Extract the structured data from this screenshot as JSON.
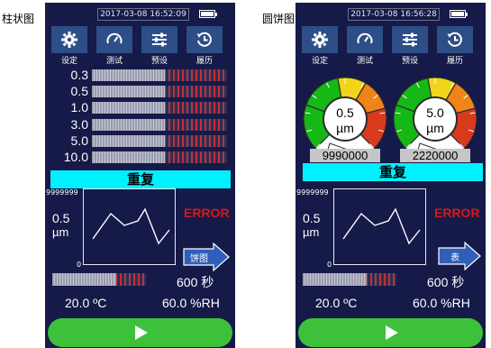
{
  "captions": {
    "left": "柱状图",
    "right": "圆饼图"
  },
  "nav": [
    {
      "icon": "gear-icon",
      "label": "设定"
    },
    {
      "icon": "gauge-icon",
      "label": "测试"
    },
    {
      "icon": "sliders-icon",
      "label": "预设"
    },
    {
      "icon": "history-icon",
      "label": "履历"
    }
  ],
  "bar_panel": {
    "datetime": "2017-03-08 16:52:09",
    "rows": [
      {
        "size": "0.3",
        "level": 0.54
      },
      {
        "size": "0.5",
        "level": 0.54
      },
      {
        "size": "1.0",
        "level": 0.54
      },
      {
        "size": "3.0",
        "level": 0.54
      },
      {
        "size": "5.0",
        "level": 0.54
      },
      {
        "size": "10.0",
        "level": 0.54
      }
    ],
    "repeat_label": "重复",
    "trend": {
      "y_max": "9999999",
      "y_min": "0",
      "size": "0.5",
      "unit": "µm"
    },
    "error": "ERROR",
    "switch_label": "饼图",
    "progress": 0.68,
    "seconds": "600 秒",
    "temperature": "20.0 ºC",
    "humidity": "60.0 %RH"
  },
  "pie_panel": {
    "datetime": "2017-03-08 16:56:28",
    "gauges": [
      {
        "size": "0.5",
        "unit": "µm",
        "count": "9990000"
      },
      {
        "size": "5.0",
        "unit": "µm",
        "count": "2220000"
      }
    ],
    "repeat_label": "重复",
    "trend": {
      "y_max": "9999999",
      "y_min": "0",
      "size": "0.5",
      "unit": "µm"
    },
    "error": "ERROR",
    "switch_label": "表",
    "progress": 0.68,
    "seconds": "600 秒",
    "temperature": "20.0 ºC",
    "humidity": "60.0 %RH"
  },
  "colors": {
    "background": "#151a48",
    "nav_button": "#2d4e86",
    "repeat_bar": "#00f0ff",
    "error": "#d81818",
    "start_button": "#3ec13a",
    "gauge_green": "#16b816",
    "gauge_yellow": "#f2d41a",
    "gauge_orange": "#f08418",
    "gauge_red": "#d83a1e"
  }
}
